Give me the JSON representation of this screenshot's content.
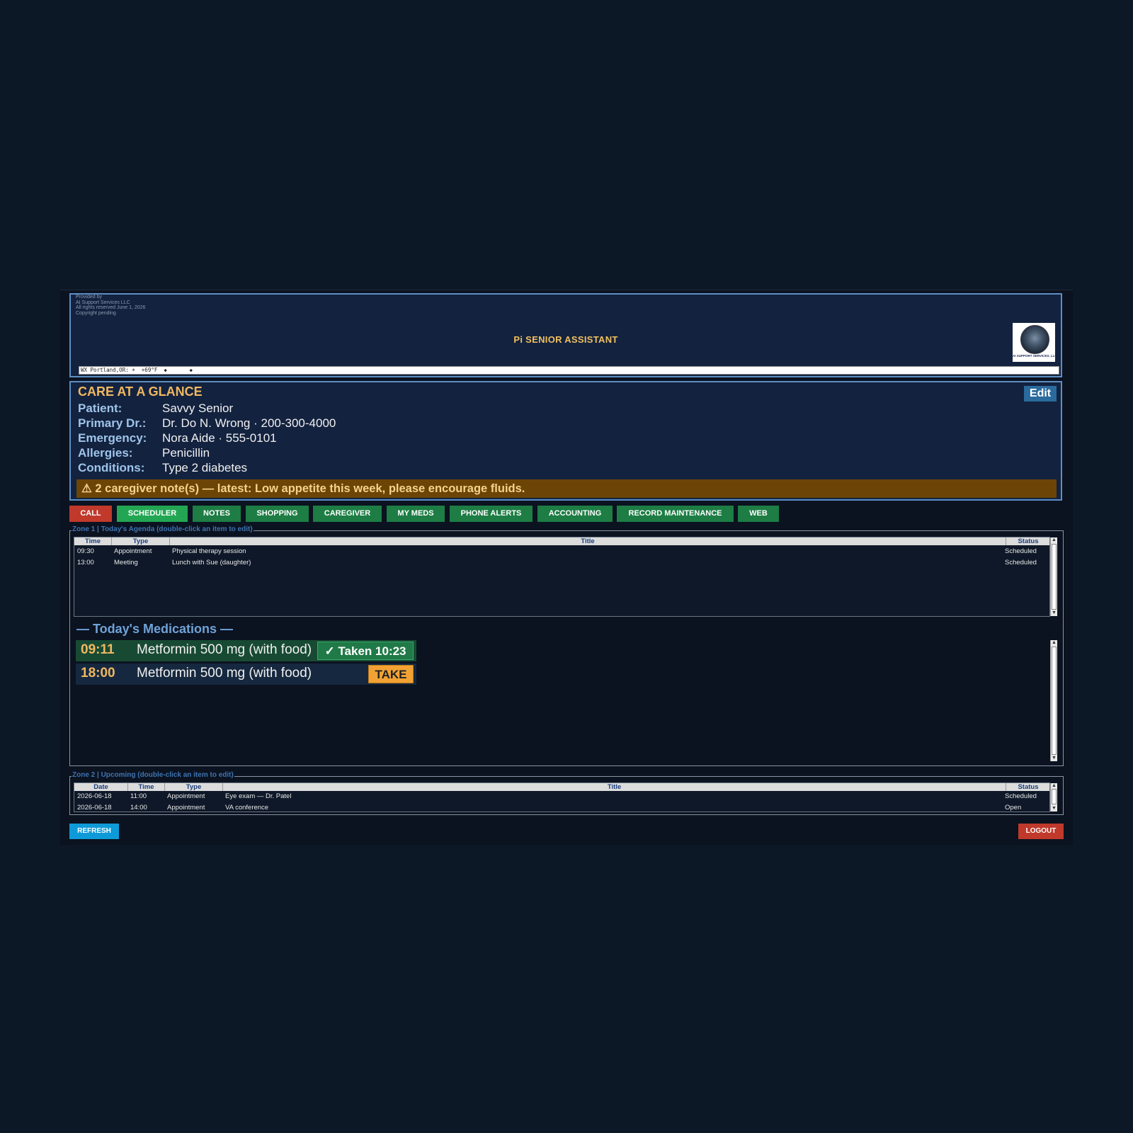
{
  "header": {
    "credit_lines": [
      "Provided by",
      "AI Support Services LLC",
      "All rights reserved  June 1, 2026",
      "Copyright pending"
    ],
    "title": "Pi SENIOR ASSISTANT",
    "logo_caption": "AI SUPPORT SERVICES, LLC",
    "weather": "WX Portland,OR: ☀  +69°F  ◆       ◆"
  },
  "care": {
    "title": "CARE AT A GLANCE",
    "edit_label": "Edit",
    "rows": [
      {
        "label": "Patient:",
        "value": "Savvy Senior"
      },
      {
        "label": "Primary Dr.:",
        "value": "Dr. Do N. Wrong · 200-300-4000"
      },
      {
        "label": "Emergency:",
        "value": "Nora Aide · 555-0101"
      },
      {
        "label": "Allergies:",
        "value": "Penicillin"
      },
      {
        "label": "Conditions:",
        "value": "Type 2 diabetes"
      }
    ],
    "note": "⚠ 2 caregiver note(s) — latest: Low appetite this week, please encourage fluids."
  },
  "toolbar": {
    "call": "CALL",
    "scheduler": "SCHEDULER",
    "notes": "NOTES",
    "shopping": "SHOPPING",
    "caregiver": "CAREGIVER",
    "my_meds": "MY MEDS",
    "phone_alerts": "PHONE ALERTS",
    "accounting": "ACCOUNTING",
    "record_maintenance": "RECORD MAINTENANCE",
    "web": "WEB"
  },
  "zone1": {
    "label": "Zone 1 | Today's Agenda  (double-click an item to edit)",
    "columns": [
      "Time",
      "Type",
      "Title",
      "Status"
    ],
    "rows": [
      {
        "time": "09:30",
        "type": "Appointment",
        "title": "Physical therapy session",
        "status": "Scheduled"
      },
      {
        "time": "13:00",
        "type": "Meeting",
        "title": "Lunch with Sue (daughter)",
        "status": "Scheduled"
      }
    ]
  },
  "meds": {
    "title": "— Today's Medications —",
    "items": [
      {
        "time": "09:11",
        "name": "Metformin 500 mg  (with food)",
        "action": "✓ Taken 10:23"
      },
      {
        "time": "18:00",
        "name": "Metformin 500 mg  (with food)",
        "action": "TAKE"
      }
    ]
  },
  "zone2": {
    "label": "Zone 2 | Upcoming  (double-click an item to edit)",
    "columns": [
      "Date",
      "Time",
      "Type",
      "Title",
      "Status"
    ],
    "rows": [
      {
        "date": "2026-06-18",
        "time": "11:00",
        "type": "Appointment",
        "title": "Eye exam — Dr. Patel",
        "status": "Scheduled"
      },
      {
        "date": "2026-06-18",
        "time": "14:00",
        "type": "Appointment",
        "title": "VA conference",
        "status": "Open"
      }
    ]
  },
  "footer": {
    "refresh": "REFRESH",
    "logout": "LOGOUT"
  },
  "colors": {
    "background": "#0c1825",
    "panel": "#13223f",
    "accent_gold": "#f0b860",
    "label_blue": "#9fc4ea",
    "button_green": "#1d7d44",
    "button_red": "#c0392b",
    "refresh_blue": "#0e9ad8",
    "take_orange": "#f2a234"
  }
}
